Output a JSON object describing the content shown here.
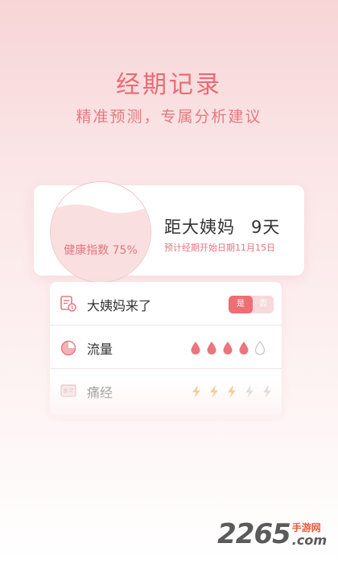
{
  "hero": {
    "title": "经期记录",
    "subtitle": "精准预测，专属分析建议"
  },
  "stats": {
    "health_label": "健康指数 75%",
    "health_index_percent": 75,
    "countdown_label": "距大姨妈",
    "countdown_days": "9天",
    "prediction_text": "预计经期开始日期11月15日"
  },
  "records": {
    "period_label": "大姨妈来了",
    "toggle_yes": "是",
    "toggle_no": "否",
    "toggle_selected": "是",
    "flow_label": "流量",
    "flow_level": 4,
    "flow_max": 5,
    "pain_label": "痛经",
    "pain_level": 3,
    "pain_max": 5
  },
  "colors": {
    "accent": "#ee6e74",
    "drop_filled": "#e8767c",
    "drop_empty": "#c9c9c9",
    "bolt_filled": "#f5b25a",
    "bolt_empty": "#cfcfcf"
  },
  "watermark": {
    "number": "2265",
    "site_cn": "手游网",
    "domain": ".com"
  }
}
